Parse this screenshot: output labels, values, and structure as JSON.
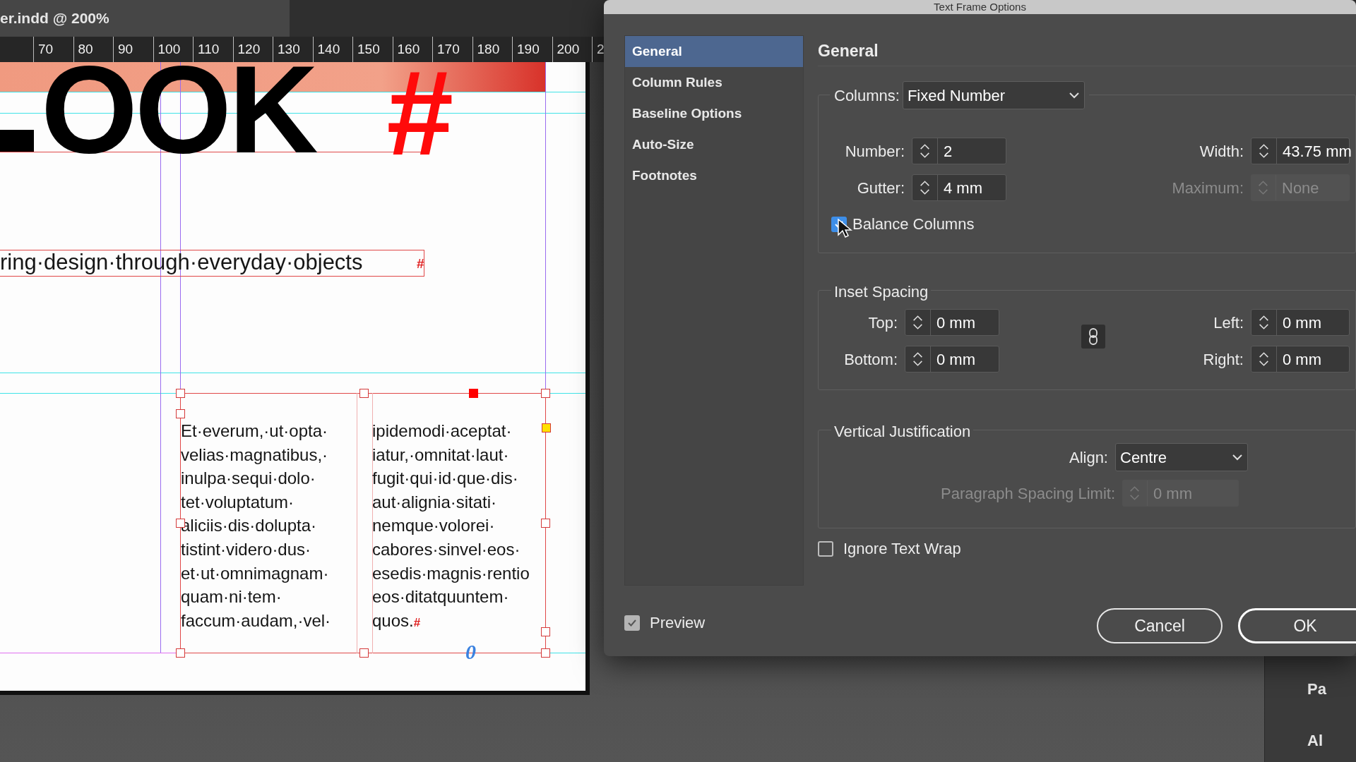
{
  "document_tab": {
    "title": "er.indd @ 200%"
  },
  "ruler": {
    "labels": [
      "70",
      "80",
      "90",
      "100",
      "110",
      "120",
      "130",
      "140",
      "150",
      "160",
      "170",
      "180",
      "190",
      "200",
      "2"
    ]
  },
  "page": {
    "headline": "OOK",
    "headline_mark": "#",
    "subtitle": "ring·design·through·everyday·objects",
    "subtitle_mark": "#",
    "columns": [
      {
        "lines": [
          "Et·everum,·ut·opta·",
          "velias·magnatibus,·",
          "inulpa·sequi·dolo·",
          "tet·voluptatum·",
          "aliciis·dis·dolupta·",
          "tistint·videro·dus·",
          "et·ut·omnimagnam·",
          "quam·ni·tem·",
          "faccum·audam,·vel·"
        ]
      },
      {
        "lines": [
          "ipidemodi·aceptat·",
          "iatur,·omnitat·laut·",
          "fugit·qui·id·que·dis·",
          "aut·alignia·sitati·",
          "nemque·volorei·",
          "cabores·sinvel·eos·",
          "esedis·magnis·rentio",
          "eos·ditatquuntem·",
          "quos."
        ],
        "end_mark": "#"
      }
    ],
    "overset_mark": "0"
  },
  "dialog": {
    "title": "Text Frame Options",
    "sections": [
      {
        "label": "General",
        "selected": true
      },
      {
        "label": "Column Rules",
        "selected": false
      },
      {
        "label": "Baseline Options",
        "selected": false
      },
      {
        "label": "Auto-Size",
        "selected": false
      },
      {
        "label": "Footnotes",
        "selected": false
      }
    ],
    "heading": "General",
    "columns": {
      "label": "Columns:",
      "value": "Fixed Number",
      "fields": [
        {
          "label": "Number:",
          "value": "2",
          "disabled": false
        },
        {
          "label": "Width:",
          "value": "43.75 mm",
          "disabled": false
        },
        {
          "label": "Gutter:",
          "value": "4 mm",
          "disabled": false
        },
        {
          "label": "Maximum:",
          "value": "None",
          "disabled": true
        }
      ],
      "balance": {
        "label": "Balance Columns",
        "checked": true
      }
    },
    "inset": {
      "title": "Inset Spacing",
      "fields": [
        {
          "label": "Top:",
          "value": "0 mm",
          "disabled": false
        },
        {
          "label": "Left:",
          "value": "0 mm",
          "disabled": false
        },
        {
          "label": "Bottom:",
          "value": "0 mm",
          "disabled": false
        },
        {
          "label": "Right:",
          "value": "0 mm",
          "disabled": false
        }
      ]
    },
    "vertical": {
      "title": "Vertical Justification",
      "align": {
        "label": "Align:",
        "value": "Centre"
      },
      "spacing": {
        "label": "Paragraph Spacing Limit:",
        "value": "0 mm",
        "disabled": true
      }
    },
    "ignore_wrap": {
      "label": "Ignore Text Wrap",
      "checked": false
    },
    "preview": {
      "label": "Preview",
      "checked": true
    },
    "buttons": [
      "Cancel",
      "OK"
    ]
  },
  "side_panel": {
    "items": [
      "Pa",
      "Al"
    ]
  }
}
